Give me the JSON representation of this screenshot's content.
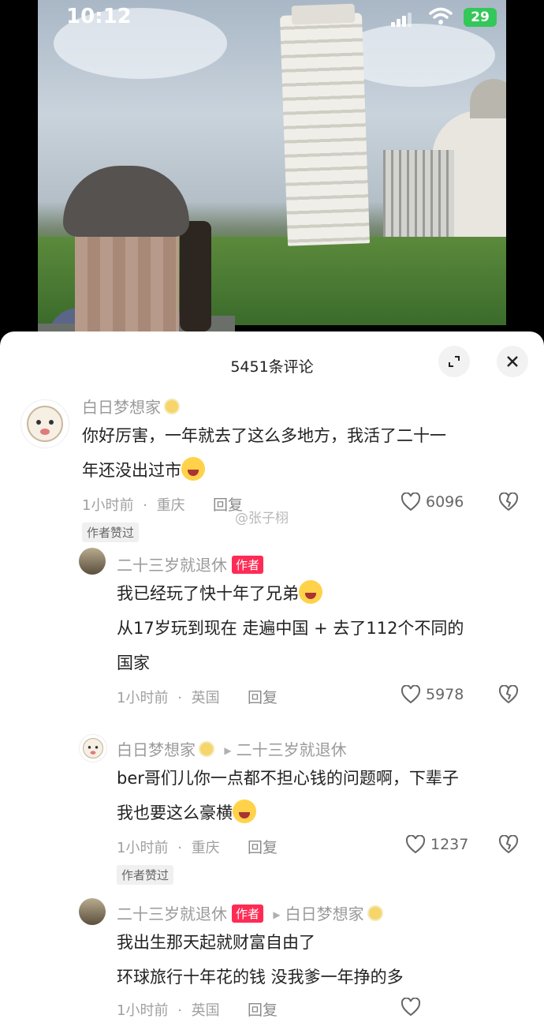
{
  "status_bar": {
    "time": "10:12",
    "battery": "29"
  },
  "header": {
    "title": "5451条评论"
  },
  "watermark": "@张子栩",
  "comments": [
    {
      "name": "白日梦想家",
      "text_line1": "你好厉害，一年就去了这么多地方，我活了二十一",
      "text_line2": "年还没出过市",
      "time": "1小时前",
      "location": "重庆",
      "reply_label": "回复",
      "likes": "6096",
      "liked_badge": "作者赞过"
    },
    {
      "name": "二十三岁就退休",
      "author_tag": "作者",
      "line1": "我已经玩了快十年了兄弟",
      "line2": "从17岁玩到现在  走遍中国 + 去了112个不同的",
      "line3": "国家",
      "time": "1小时前",
      "location": "英国",
      "reply_label": "回复",
      "likes": "5978"
    },
    {
      "name": "白日梦想家",
      "reply_to": "二十三岁就退休",
      "line1": "ber哥们儿你一点都不担心钱的问题啊，下辈子",
      "line2": "我也要这么豪横",
      "time": "1小时前",
      "location": "重庆",
      "reply_label": "回复",
      "likes": "1237",
      "liked_badge": "作者赞过"
    },
    {
      "name": "二十三岁就退休",
      "author_tag": "作者",
      "reply_to": "白日梦想家",
      "line1": "我出生那天起就财富自由了",
      "line2": "环球旅行十年花的钱 没我爹一年挣的多",
      "time": "1小时前",
      "location": "英国",
      "reply_label": "回复"
    }
  ],
  "meta_separator": "·"
}
